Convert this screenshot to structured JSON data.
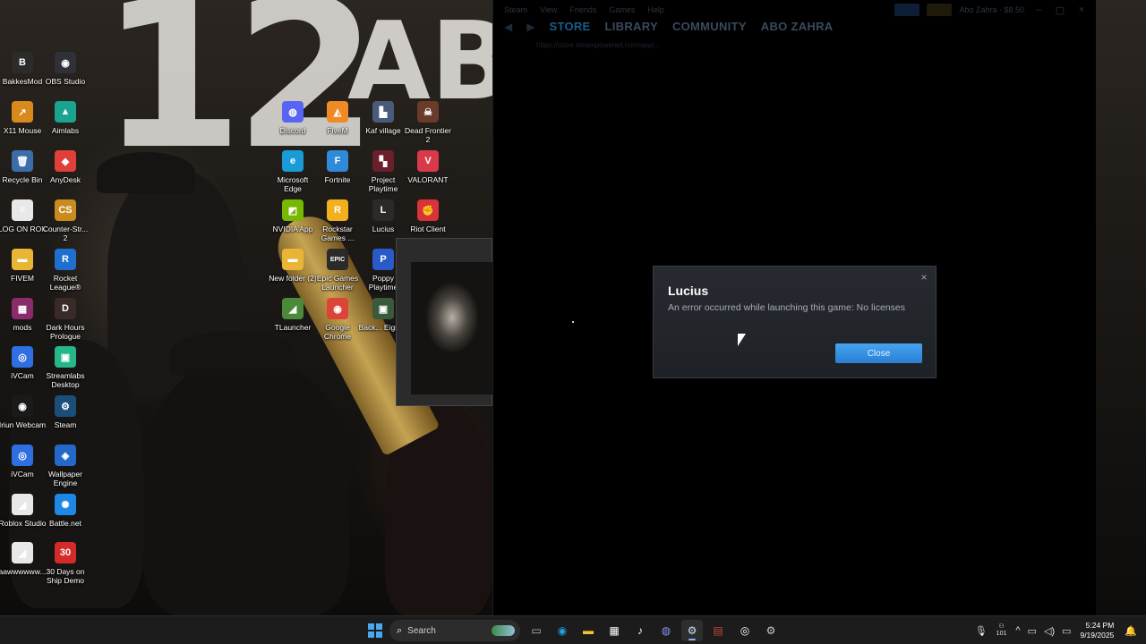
{
  "wallpaper": {
    "number": "12",
    "word": "ABO"
  },
  "desktop_icons": [
    {
      "label": "BakkesMod",
      "glyph": "B",
      "color": "#2b2b2b"
    },
    {
      "label": "OBS Studio",
      "glyph": "◉",
      "color": "#303038"
    },
    {
      "label": "X11 Mouse",
      "glyph": "↗",
      "color": "#d98a1c"
    },
    {
      "label": "Aimlabs",
      "glyph": "▲",
      "color": "#1aa38f"
    },
    {
      "label": "Recycle Bin",
      "glyph": "🗑",
      "color": "#3b6ea8"
    },
    {
      "label": "AnyDesk",
      "glyph": "◆",
      "color": "#e0403a"
    },
    {
      "label": "LOG ON ROK",
      "glyph": "≡",
      "color": "#e8e8e8"
    },
    {
      "label": "Counter-Str... 2",
      "glyph": "CS",
      "color": "#c98a1e"
    },
    {
      "label": "FIVEM",
      "glyph": "▬",
      "color": "#e8b634"
    },
    {
      "label": "Rocket League®",
      "glyph": "R",
      "color": "#1f6fd1"
    },
    {
      "label": "mods",
      "glyph": "▦",
      "color": "#8a2b6a"
    },
    {
      "label": "Dark Hours Prologue",
      "glyph": "D",
      "color": "#3a2a28"
    },
    {
      "label": "iVCam",
      "glyph": "◎",
      "color": "#2f6fe0"
    },
    {
      "label": "Streamlabs Desktop",
      "glyph": "▣",
      "color": "#27b58a"
    },
    {
      "label": "Iriun Webcam",
      "glyph": "◉",
      "color": "#1a1a1a"
    },
    {
      "label": "Steam",
      "glyph": "⚙",
      "color": "#1b4f7a"
    },
    {
      "label": "iVCam",
      "glyph": "◎",
      "color": "#2f6fe0"
    },
    {
      "label": "Wallpaper Engine",
      "glyph": "◈",
      "color": "#2468c8"
    },
    {
      "label": "Roblox Studio",
      "glyph": "◢",
      "color": "#e8e8e8"
    },
    {
      "label": "Battle.net",
      "glyph": "✺",
      "color": "#1e88e5"
    },
    {
      "label": "aawwwwww...",
      "glyph": "◢",
      "color": "#e8e8e8"
    },
    {
      "label": "30 Days on Ship Demo",
      "glyph": "30",
      "color": "#d32a2a"
    },
    {
      "label": "Discord",
      "glyph": "◍",
      "color": "#5865f2"
    },
    {
      "label": "FiveM",
      "glyph": "◭",
      "color": "#f08a24"
    },
    {
      "label": "Kaf village",
      "glyph": "▙",
      "color": "#4a5a7a"
    },
    {
      "label": "Dead Frontier 2",
      "glyph": "☠",
      "color": "#6a3a2a"
    },
    {
      "label": "Microsoft Edge",
      "glyph": "e",
      "color": "#1a9bd8"
    },
    {
      "label": "Fortnite",
      "glyph": "F",
      "color": "#2f8ad8"
    },
    {
      "label": "Project Playtime",
      "glyph": "▚",
      "color": "#6a1f2a"
    },
    {
      "label": "VALORANT",
      "glyph": "V",
      "color": "#d83a4a"
    },
    {
      "label": "NVIDIA App",
      "glyph": "◩",
      "color": "#76b900"
    },
    {
      "label": "Rockstar Games ...",
      "glyph": "R",
      "color": "#f2b01e"
    },
    {
      "label": "Lucius",
      "glyph": "L",
      "color": "#2a2a2a"
    },
    {
      "label": "Riot Client",
      "glyph": "✊",
      "color": "#d8323a"
    },
    {
      "label": "New folder (2)",
      "glyph": "▬",
      "color": "#e8b634"
    },
    {
      "label": "Epic Games Launcher",
      "glyph": "EPIC",
      "color": "#2a2a2a"
    },
    {
      "label": "Poppy Playtime",
      "glyph": "P",
      "color": "#2a5ac8"
    },
    {
      "label": "TLauncher",
      "glyph": "◢",
      "color": "#4a8a3a"
    },
    {
      "label": "Google Chrome",
      "glyph": "◉",
      "color": "#db4437"
    },
    {
      "label": "Back... Eight...",
      "glyph": "▣",
      "color": "#3a5a3a"
    }
  ],
  "steam": {
    "menu": [
      "Steam",
      "View",
      "Friends",
      "Games",
      "Help"
    ],
    "tabs": [
      "STORE",
      "LIBRARY",
      "COMMUNITY",
      "ABO ZAHRA"
    ],
    "url": "https://store.steampowered.com/app/...",
    "user": "Abo Zahra · $8.50"
  },
  "dialog": {
    "title": "Lucius",
    "message": "An error occurred while launching this game: No licenses",
    "close_label": "Close",
    "close_icon": "×"
  },
  "taskbar": {
    "search_label": "Search",
    "time": "5:24 PM",
    "date": "9/19/2025",
    "temp": "101",
    "accent": "#4aa8f0"
  }
}
